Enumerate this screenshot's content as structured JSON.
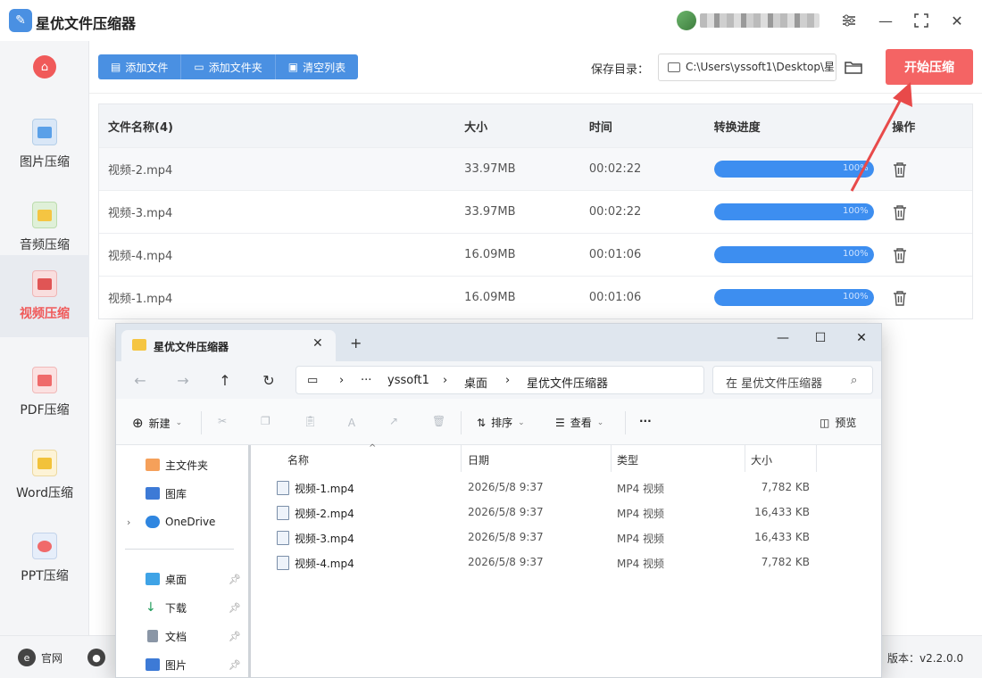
{
  "app": {
    "title": "星优文件压缩器",
    "version_label": "版本：v2.2.0.0"
  },
  "sidebar": {
    "items": [
      {
        "label": "图片压缩",
        "icon": "image-compress-icon"
      },
      {
        "label": "音频压缩",
        "icon": "audio-compress-icon"
      },
      {
        "label": "视频压缩",
        "icon": "video-compress-icon",
        "active": true
      },
      {
        "label": "PDF压缩",
        "icon": "pdf-compress-icon"
      },
      {
        "label": "Word压缩",
        "icon": "word-compress-icon"
      },
      {
        "label": "PPT压缩",
        "icon": "ppt-compress-icon"
      }
    ]
  },
  "toolbar": {
    "add_file": "添加文件",
    "add_folder": "添加文件夹",
    "clear_list": "清空列表",
    "save_dir_label": "保存目录：",
    "save_dir_value": "C:\\Users\\yssoft1\\Desktop\\星",
    "start_button": "开始压缩"
  },
  "table": {
    "headers": [
      "文件名称(4)",
      "大小",
      "时间",
      "转换进度",
      "操作"
    ],
    "rows": [
      {
        "name": "视频-2.mp4",
        "size": "33.97MB",
        "time": "00:02:22",
        "progress": 100,
        "progress_text": "100%"
      },
      {
        "name": "视频-3.mp4",
        "size": "33.97MB",
        "time": "00:02:22",
        "progress": 100,
        "progress_text": "100%"
      },
      {
        "name": "视频-4.mp4",
        "size": "16.09MB",
        "time": "00:01:06",
        "progress": 100,
        "progress_text": "100%"
      },
      {
        "name": "视频-1.mp4",
        "size": "16.09MB",
        "time": "00:01:06",
        "progress": 100,
        "progress_text": "100%"
      }
    ]
  },
  "footer": {
    "website": "官网"
  },
  "explorer": {
    "tab_title": "星优文件压缩器",
    "breadcrumb": [
      "yssoft1",
      "桌面",
      "星优文件压缩器"
    ],
    "search_placeholder": "在 星优文件压缩器",
    "commands": {
      "new": "新建",
      "sort": "排序",
      "view": "查看",
      "preview": "预览"
    },
    "nav": [
      {
        "label": "主文件夹"
      },
      {
        "label": "图库"
      },
      {
        "label": "OneDrive"
      },
      {
        "label": "桌面"
      },
      {
        "label": "下载"
      },
      {
        "label": "文档"
      },
      {
        "label": "图片"
      }
    ],
    "columns": [
      "名称",
      "日期",
      "类型",
      "大小"
    ],
    "files": [
      {
        "name": "视频-1.mp4",
        "date": "2026/5/8 9:37",
        "type": "MP4 视频",
        "size": "7,782 KB"
      },
      {
        "name": "视频-2.mp4",
        "date": "2026/5/8 9:37",
        "type": "MP4 视频",
        "size": "16,433 KB"
      },
      {
        "name": "视频-3.mp4",
        "date": "2026/5/8 9:37",
        "type": "MP4 视频",
        "size": "16,433 KB"
      },
      {
        "name": "视频-4.mp4",
        "date": "2026/5/8 9:37",
        "type": "MP4 视频",
        "size": "7,782 KB"
      }
    ]
  },
  "colors": {
    "accent": "#4a90e2",
    "start_button": "#f46464",
    "progress": "#3d8ef0",
    "active_label": "#f05a5a"
  }
}
